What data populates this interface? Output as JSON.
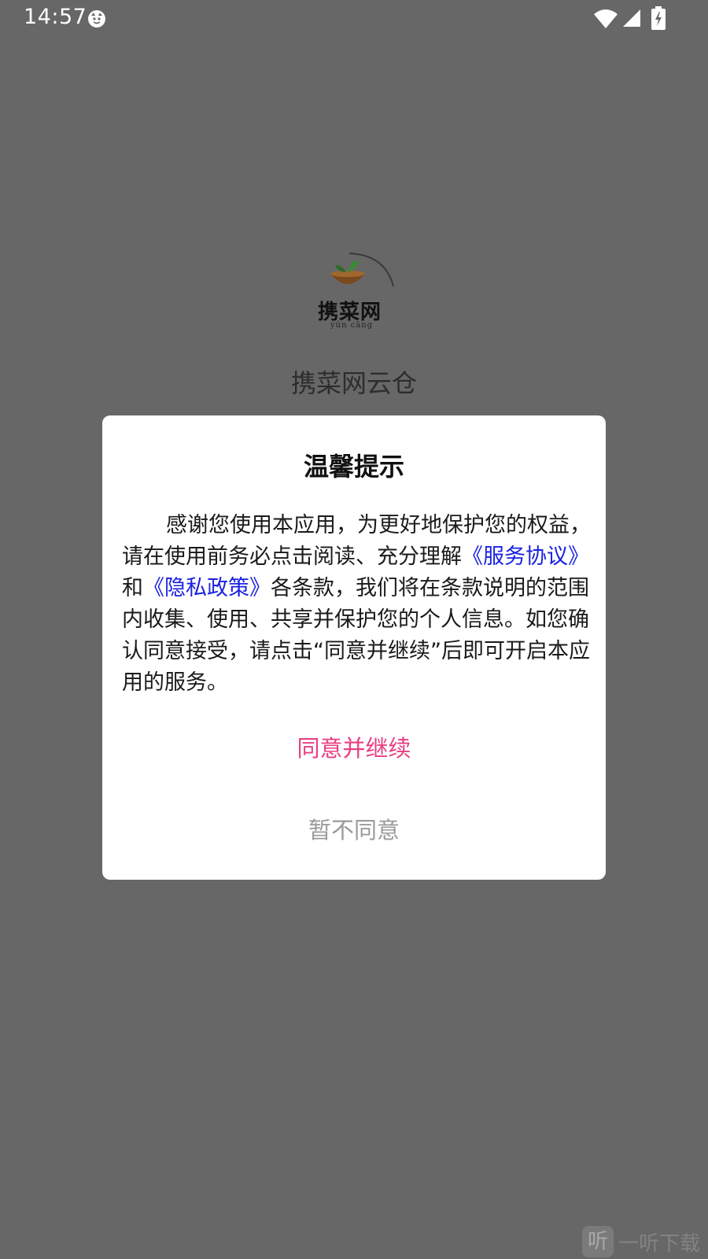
{
  "status_bar": {
    "time": "14:57",
    "icons": [
      "app-notification-icon",
      "wifi-icon",
      "cell-signal-icon",
      "battery-charging-icon"
    ]
  },
  "splash": {
    "logo_text": "携菜网",
    "logo_subtext": "yún cāng",
    "app_name": "携菜网云仓"
  },
  "dialog": {
    "title": "温馨提示",
    "body_part1": "感谢您使用本应用，为更好地保护您的权益，请在使用前务必点击阅读、充分理解",
    "service_link": "《服务协议》",
    "body_and": "和",
    "privacy_link": "《隐私政策》",
    "body_part2": "各条款，我们将在条款说明的范围内收集、使用、共享并保护您的个人信息。如您确认同意接受，请点击“同意并继续”后即可开启本应用的服务。",
    "agree_label": "同意并继续",
    "disagree_label": "暂不同意"
  },
  "watermark": {
    "logo_glyph": "听",
    "text": "一听下载"
  },
  "colors": {
    "overlay": "#676767",
    "link": "#1a22e0",
    "agree": "#e83f80",
    "disagree": "#9a9a9a"
  }
}
